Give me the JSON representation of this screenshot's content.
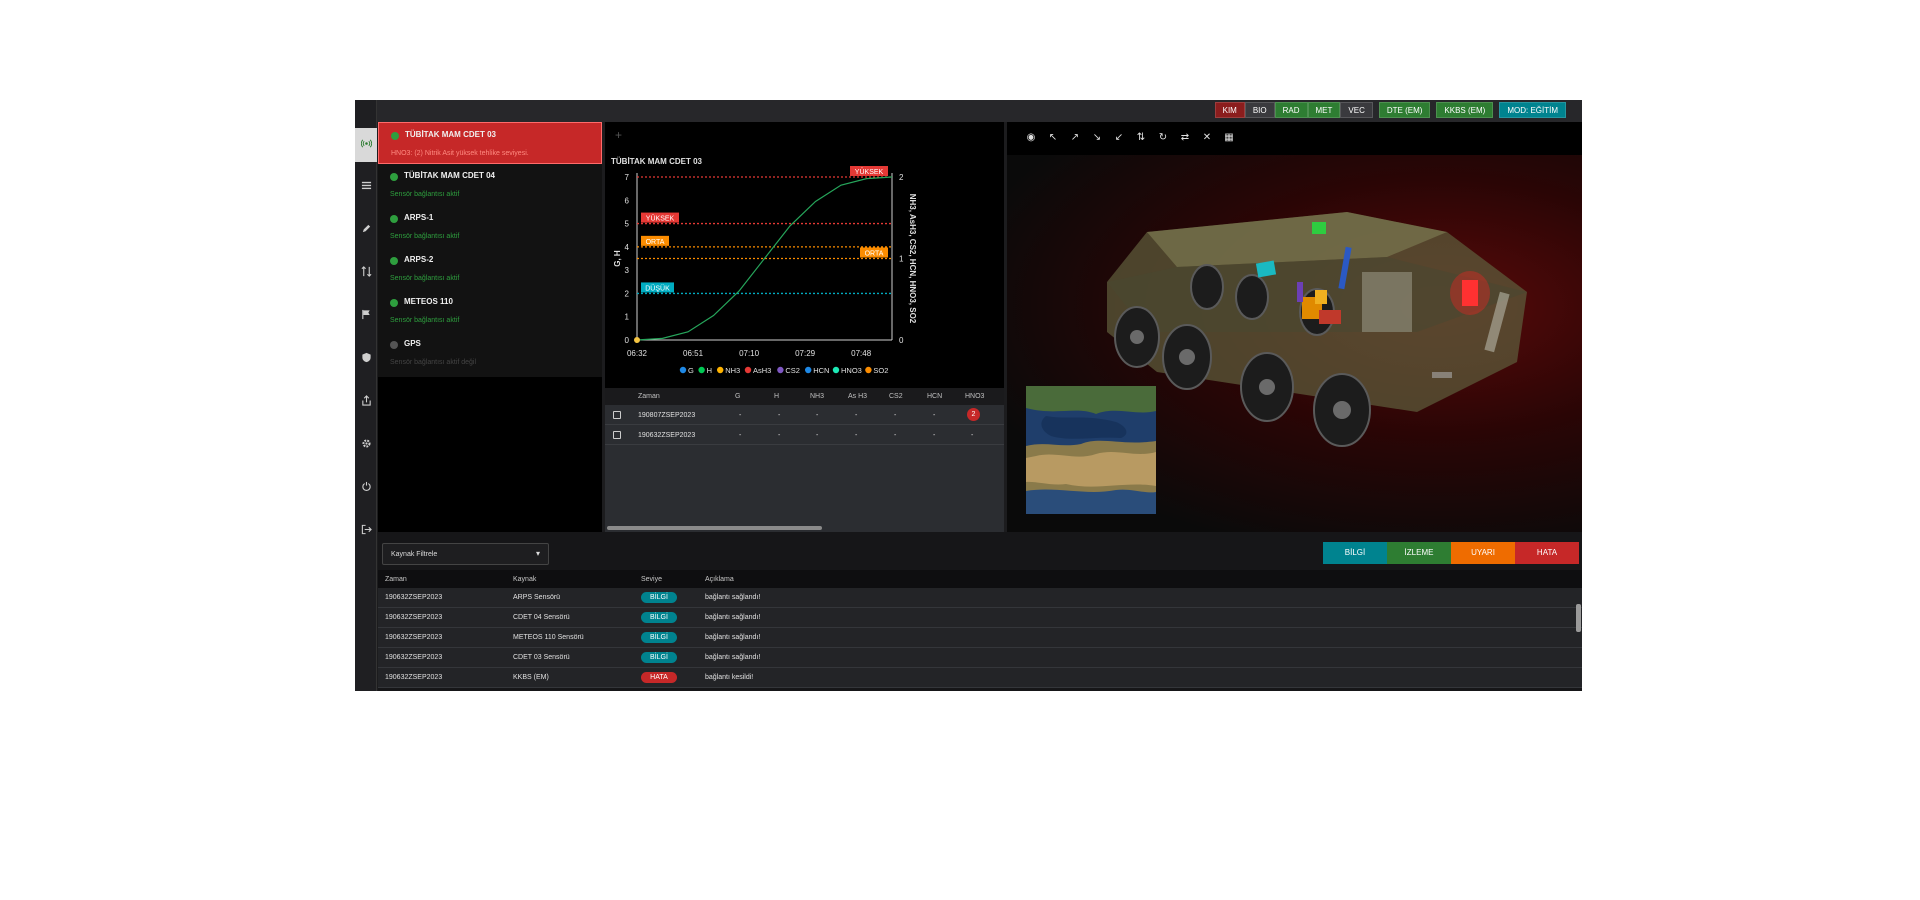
{
  "topbar": {
    "badges": [
      {
        "label": "KIM",
        "color": "red"
      },
      {
        "label": "BIO",
        "color": "gray"
      },
      {
        "label": "RAD",
        "color": "green"
      },
      {
        "label": "MET",
        "color": "green"
      },
      {
        "label": "VEC",
        "color": "gray"
      }
    ],
    "dte": "DTE (EM)",
    "kkbs": "KKBS (EM)",
    "mode": "MOD: EĞİTİM"
  },
  "sidebar": {
    "items": [
      {
        "icon": "broadcast-icon",
        "active": true
      },
      {
        "icon": "list-icon"
      },
      {
        "icon": "pencil-icon"
      },
      {
        "icon": "sort-icon"
      },
      {
        "icon": "flag-icon"
      },
      {
        "icon": "shield-icon"
      },
      {
        "icon": "share-icon"
      },
      {
        "icon": "gear-icon"
      },
      {
        "icon": "power-icon"
      },
      {
        "icon": "logout-icon"
      }
    ]
  },
  "sensors": [
    {
      "name": "TÜBİTAK MAM CDET 03",
      "status": "HNO3: (2) Nitrik Asit yüksek tehlike seviyesi.",
      "state": "alert"
    },
    {
      "name": "TÜBİTAK MAM CDET 04",
      "status": "Sensör bağlantısı aktif",
      "state": "ok"
    },
    {
      "name": "ARPS-1",
      "status": "Sensör bağlantısı aktif",
      "state": "ok"
    },
    {
      "name": "ARPS-2",
      "status": "Sensör bağlantısı aktif",
      "state": "ok"
    },
    {
      "name": "METEOS 110",
      "status": "Sensör bağlantısı aktif",
      "state": "ok"
    },
    {
      "name": "GPS",
      "status": "Sensör bağlantısı aktif değil",
      "state": "off"
    }
  ],
  "chart": {
    "plus": "+",
    "title": "TÜBİTAK MAM CDET 03"
  },
  "chart_data": {
    "type": "line",
    "x": [
      "06:32",
      "06:51",
      "07:10",
      "07:29",
      "07:48"
    ],
    "x_ticks": [
      "06:32",
      "06:51",
      "07:10",
      "07:29",
      "07:48"
    ],
    "ylabel_left": "G, H",
    "ylabel_right": "NH3, AsH3, CS2, HCN, HNO3, SO2",
    "ylim_left": [
      0,
      7
    ],
    "ylim_right": [
      0,
      2
    ],
    "yticks_left": [
      "0",
      "1",
      "2",
      "3",
      "4",
      "5",
      "6",
      "7"
    ],
    "yticks_right": [
      "0",
      "1",
      "2"
    ],
    "thresholds": [
      {
        "label": "YÜKSEK",
        "axis": "right",
        "value": 2,
        "color": "#e53935"
      },
      {
        "label": "YÜKSEK",
        "axis": "left",
        "value": 5,
        "color": "#e53935"
      },
      {
        "label": "ORTA",
        "axis": "left",
        "value": 4,
        "color": "#fb8c00"
      },
      {
        "label": "ORTA",
        "axis": "right",
        "value": 1,
        "color": "#fb8c00"
      },
      {
        "label": "DÜŞÜK",
        "axis": "left",
        "value": 2,
        "color": "#00acc1"
      }
    ],
    "series": [
      {
        "name": "HNO3",
        "axis": "right",
        "color": "#26a65b",
        "points": [
          [
            0,
            0
          ],
          [
            0.1,
            0.02
          ],
          [
            0.2,
            0.1
          ],
          [
            0.3,
            0.3
          ],
          [
            0.4,
            0.6
          ],
          [
            0.5,
            1.0
          ],
          [
            0.6,
            1.4
          ],
          [
            0.7,
            1.7
          ],
          [
            0.8,
            1.9
          ],
          [
            0.9,
            1.98
          ],
          [
            1.0,
            2.0
          ]
        ]
      }
    ],
    "legend": [
      {
        "name": "G",
        "color": "#1e88e5"
      },
      {
        "name": "H",
        "color": "#00c853"
      },
      {
        "name": "NH3",
        "color": "#ffb300"
      },
      {
        "name": "AsH3",
        "color": "#e53935"
      },
      {
        "name": "CS2",
        "color": "#7e57c2"
      },
      {
        "name": "HCN",
        "color": "#1e88e5"
      },
      {
        "name": "HNO3",
        "color": "#1de9b6"
      },
      {
        "name": "SO2",
        "color": "#fb8c00"
      }
    ]
  },
  "table": {
    "headers": [
      "Zaman",
      "G",
      "H",
      "NH3",
      "As H3",
      "CS2",
      "HCN",
      "HNO3"
    ],
    "rows": [
      {
        "time": "190807ZSEP2023",
        "cells": [
          "-",
          "-",
          "-",
          "-",
          "-",
          "-"
        ],
        "hno3": "2"
      },
      {
        "time": "190632ZSEP2023",
        "cells": [
          "-",
          "-",
          "-",
          "-",
          "-",
          "-"
        ],
        "hno3": "-"
      }
    ]
  },
  "vehicle_panel": {
    "tools": [
      {
        "icon": "eye-icon",
        "glyph": "◉"
      },
      {
        "icon": "arrow-up-left-icon",
        "glyph": "↖"
      },
      {
        "icon": "arrow-up-right-icon",
        "glyph": "↗"
      },
      {
        "icon": "arrow-down-right-icon",
        "glyph": "↘"
      },
      {
        "icon": "arrow-down-left-icon",
        "glyph": "↙"
      },
      {
        "icon": "swap-vertical-icon",
        "glyph": "⇅"
      },
      {
        "icon": "rotate-icon",
        "glyph": "↻"
      },
      {
        "icon": "swap-horizontal-icon",
        "glyph": "⇄"
      },
      {
        "icon": "shrink-icon",
        "glyph": "✕"
      },
      {
        "icon": "grid-icon",
        "glyph": "▦"
      }
    ]
  },
  "log": {
    "filter_label": "Kaynak Filtrele",
    "levels": [
      {
        "label": "BİLGİ",
        "color": "#00838f"
      },
      {
        "label": "İZLEME",
        "color": "#2e7d32"
      },
      {
        "label": "UYARI",
        "color": "#ef6c00"
      },
      {
        "label": "HATA",
        "color": "#c62828"
      }
    ],
    "headers": [
      "Zaman",
      "Kaynak",
      "Seviye",
      "Açıklama"
    ],
    "rows": [
      {
        "time": "190632ZSEP2023",
        "source": "ARPS Sensörü",
        "level": "BİLGİ",
        "level_color": "#00838f",
        "desc": "bağlantı sağlandı!"
      },
      {
        "time": "190632ZSEP2023",
        "source": "CDET 04 Sensörü",
        "level": "BİLGİ",
        "level_color": "#00838f",
        "desc": "bağlantı sağlandı!"
      },
      {
        "time": "190632ZSEP2023",
        "source": "METEOS 110 Sensörü",
        "level": "BİLGİ",
        "level_color": "#00838f",
        "desc": "bağlantı sağlandı!"
      },
      {
        "time": "190632ZSEP2023",
        "source": "CDET 03 Sensörü",
        "level": "BİLGİ",
        "level_color": "#00838f",
        "desc": "bağlantı sağlandı!"
      },
      {
        "time": "190632ZSEP2023",
        "source": "KKBS (EM)",
        "level": "HATA",
        "level_color": "#c62828",
        "desc": "bağlantı kesildi!"
      }
    ]
  }
}
